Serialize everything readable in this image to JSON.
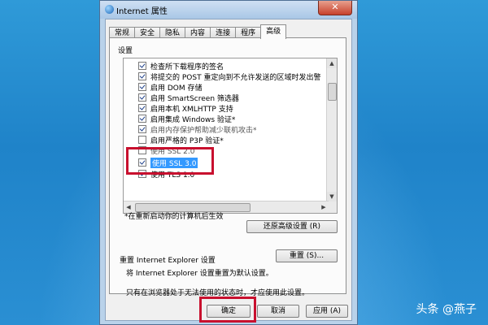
{
  "window": {
    "title": "Internet 属性",
    "close_glyph": "✕"
  },
  "tabs": [
    {
      "label": "常规"
    },
    {
      "label": "安全"
    },
    {
      "label": "隐私"
    },
    {
      "label": "内容"
    },
    {
      "label": "连接"
    },
    {
      "label": "程序"
    },
    {
      "label": "高级"
    }
  ],
  "settings": {
    "group_label": "设置",
    "items": [
      {
        "label": "检查所下载程序的签名",
        "checked": true
      },
      {
        "label": "将提交的 POST 重定向到不允许发送的区域时发出警",
        "checked": true
      },
      {
        "label": "启用 DOM 存储",
        "checked": true
      },
      {
        "label": "启用 SmartScreen 筛选器",
        "checked": true
      },
      {
        "label": "启用本机 XMLHTTP 支持",
        "checked": true
      },
      {
        "label": "启用集成 Windows 验证*",
        "checked": true
      },
      {
        "label": "启用内存保护帮助减少联机攻击*",
        "checked": true
      },
      {
        "label": "启用严格的 P3P 验证*",
        "checked": false
      },
      {
        "label": "使用 SSL 2.0",
        "checked": false
      },
      {
        "label": "使用 SSL 3.0",
        "checked": true
      },
      {
        "label": "使用 TLS 1.0",
        "checked": true
      }
    ],
    "restart_note": "*在重新启动你的计算机后生效",
    "restore_button": "还原高级设置 (R)"
  },
  "reset": {
    "title": "重置 Internet Explorer 设置",
    "description": "将 Internet Explorer 设置重置为默认设置。",
    "button": "重置 (S)...",
    "warning": "只有在浏览器处于无法使用的状态时，才应使用此设置。"
  },
  "footer": {
    "ok": "确定",
    "cancel": "取消",
    "apply": "应用 (A)"
  },
  "watermark": "头条 @燕子",
  "colors": {
    "highlight_red": "#c8102e",
    "selection_blue": "#3399ff"
  }
}
